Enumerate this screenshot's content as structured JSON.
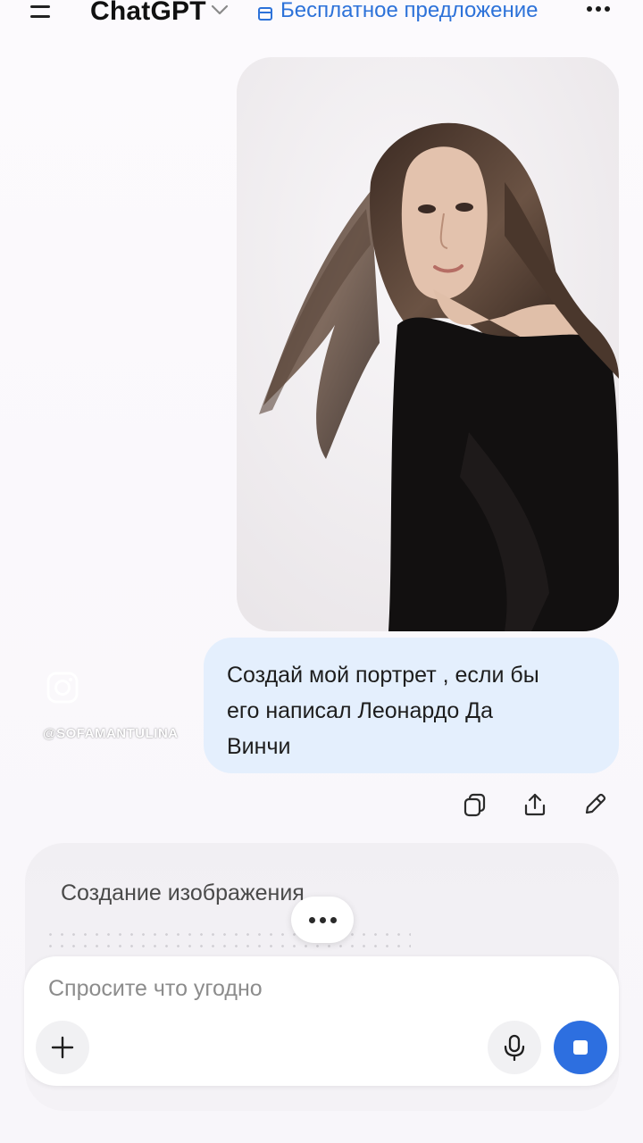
{
  "header": {
    "menu_icon": "hamburger-menu-icon",
    "title": "ChatGPT",
    "title_chevron_icon": "chevron-down-icon",
    "promo_label": "Бесплатное предложение",
    "promo_icon": "gift-icon",
    "more_icon": "more-horizontal-icon"
  },
  "attachment": {
    "type": "photo",
    "icon": "portrait-photo"
  },
  "watermark": {
    "icon": "instagram-icon",
    "handle": "@SOFAMANTULINA"
  },
  "user_message": {
    "text": "Создай мой портрет , если бы\nего написал Леонардо Да\nВинчи"
  },
  "message_actions": [
    {
      "name": "copy",
      "icon": "copy-icon"
    },
    {
      "name": "share",
      "icon": "share-icon"
    },
    {
      "name": "edit",
      "icon": "pencil-icon"
    }
  ],
  "image_generation": {
    "title": "Создание изображения",
    "typing_icon": "ellipsis-icon"
  },
  "composer": {
    "placeholder": "Спросите что угодно",
    "value": "",
    "add_icon": "plus-icon",
    "mic_icon": "microphone-icon",
    "stop_icon": "stop-icon"
  },
  "colors": {
    "accent": "#2d6fe0",
    "promo_text": "#2d72d9",
    "user_bubble": "#e4effd",
    "background": "#fbf9fc"
  }
}
